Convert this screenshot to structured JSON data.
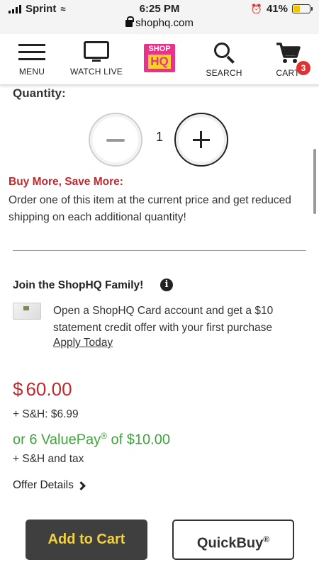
{
  "status_bar": {
    "carrier": "Sprint",
    "time": "6:25 PM",
    "battery": "41%",
    "url": "shophq.com",
    "icons": [
      "signal-icon",
      "wifi-icon",
      "alarm-icon",
      "battery-icon",
      "lock-icon"
    ]
  },
  "nav": {
    "menu_label": "MENU",
    "watch_label": "WATCH LIVE",
    "logo_top": "SHOP",
    "logo_bottom": "HQ",
    "search_label": "SEARCH",
    "cart_label": "CART",
    "cart_count": "3",
    "colors": {
      "logo_bg": "#e8328b",
      "logo_accent": "#f7d226",
      "badge": "#dd3333"
    }
  },
  "quantity": {
    "label": "Quantity:",
    "value": "1"
  },
  "promo": {
    "title": "Buy More, Save More:",
    "text": "Order one of this item at the current price and get reduced shipping on each additional quantity!"
  },
  "join": {
    "title": "Join the ShopHQ Family!",
    "card_text": "Open a ShopHQ Card account and get a $10 statement credit offer with your first purchase",
    "link": "Apply Today"
  },
  "pricing": {
    "currency": "$",
    "price": "60.00",
    "shipping": "+ S&H: $6.99",
    "valuepay_prefix": "or 6 ValuePay",
    "valuepay_reg": "®",
    "valuepay_suffix": " of $10.00",
    "shipping_tax": "+ S&H and tax",
    "offer_details": "Offer Details",
    "colors": {
      "price": "#c0282d",
      "valuepay": "#3fa33c"
    }
  },
  "actions": {
    "add_to_cart": "Add to Cart",
    "quickbuy": "QuickBuy",
    "quickbuy_reg": "®",
    "colors": {
      "add_bg": "#3f3f3f",
      "add_text": "#f4d23a"
    }
  }
}
